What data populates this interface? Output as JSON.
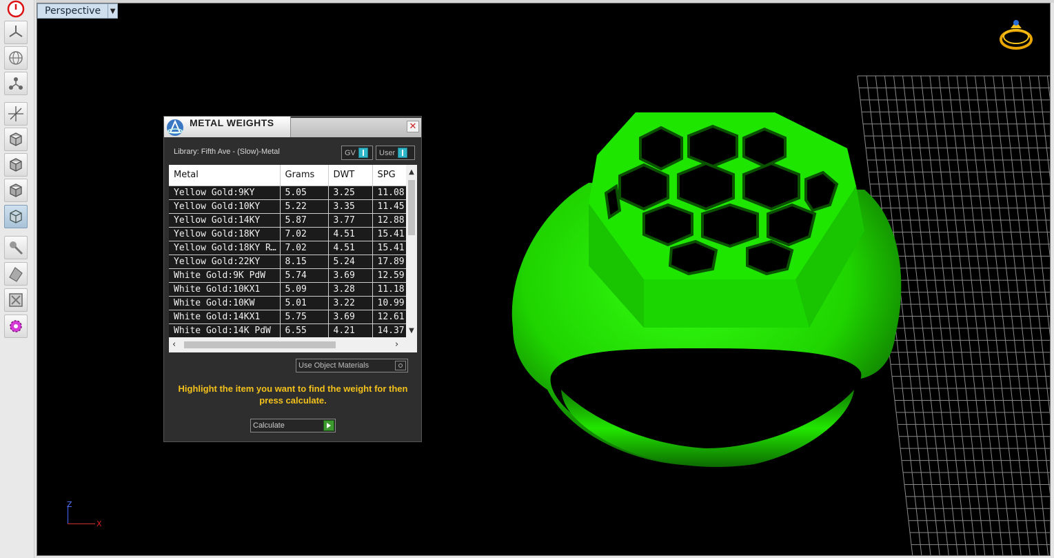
{
  "viewport": {
    "view_name": "Perspective",
    "axis_z": "Z",
    "axis_x": "X"
  },
  "toolbar": {
    "icons": [
      "power-icon",
      "propeller-icon",
      "globe-icon",
      "nodes-icon",
      "transform-axes-icon",
      "cube-view-1-icon",
      "cube-view-2-icon",
      "cube-view-3-icon",
      "cube-view-4-icon",
      "render-icon",
      "materials-icon",
      "tools-icon",
      "plugin-gear-icon"
    ],
    "active_index": 8
  },
  "dialog": {
    "title": "METAL WEIGHTS",
    "library_label": "Library: Fifth Ave - (Slow)-Metal",
    "toggle_gv": "GV",
    "toggle_user": "User",
    "columns": [
      "Metal",
      "Grams",
      "DWT",
      "SPG"
    ],
    "rows": [
      [
        "Yellow Gold:9KY",
        "5.05",
        "3.25",
        "11.08"
      ],
      [
        "Yellow Gold:10KY",
        "5.22",
        "3.35",
        "11.45"
      ],
      [
        "Yellow Gold:14KY",
        "5.87",
        "3.77",
        "12.88"
      ],
      [
        "Yellow Gold:18KY",
        "7.02",
        "4.51",
        "15.41"
      ],
      [
        "Yellow Gold:18KY R...",
        "7.02",
        "4.51",
        "15.41"
      ],
      [
        "Yellow Gold:22KY",
        "8.15",
        "5.24",
        "17.89"
      ],
      [
        "White Gold:9K PdW",
        "5.74",
        "3.69",
        "12.59"
      ],
      [
        "White Gold:10KX1",
        "5.09",
        "3.28",
        "11.18"
      ],
      [
        "White Gold:10KW",
        "5.01",
        "3.22",
        "10.99"
      ],
      [
        "White Gold:14KX1",
        "5.75",
        "3.69",
        "12.61"
      ],
      [
        "White Gold:14K PdW",
        "6.55",
        "4.21",
        "14.37"
      ]
    ],
    "use_object_materials": "Use Object Materials",
    "hint": "Highlight the item you want to find the weight for then press calculate.",
    "calculate_label": "Calculate",
    "close_symbol": "✕"
  },
  "colors": {
    "ring_green": "#22ee00",
    "hint_yellow": "#f4c21b",
    "toggle_teal": "#2fb7c9"
  }
}
